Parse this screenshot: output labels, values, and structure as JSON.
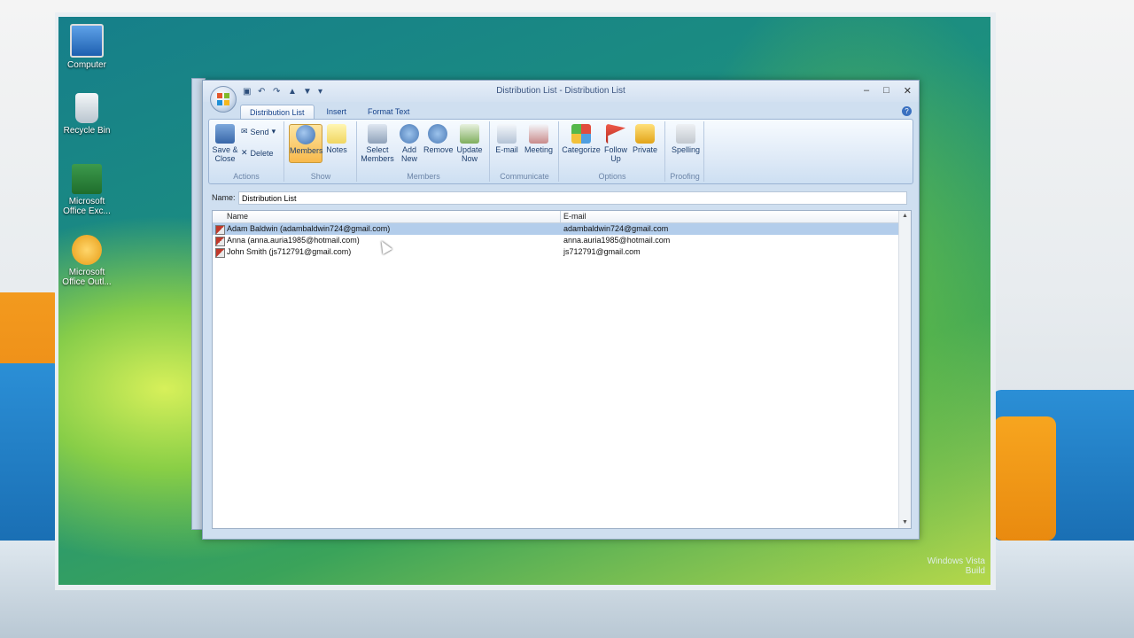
{
  "desktop": {
    "icons": [
      {
        "label": "Computer",
        "icon": "computer-icon"
      },
      {
        "label": "Recycle Bin",
        "icon": "recycle-bin-icon"
      },
      {
        "label": "Microsoft Office Exc...",
        "icon": "excel-icon"
      },
      {
        "label": "Microsoft Office Outl...",
        "icon": "outlook-icon"
      }
    ],
    "watermark": "Windows Vista\nBuild"
  },
  "window": {
    "title": "Distribution List - Distribution List",
    "tabs": [
      "Distribution List",
      "Insert",
      "Format Text"
    ],
    "active_tab": 0,
    "ribbon": {
      "groups": [
        {
          "label": "Actions",
          "buttons": [
            {
              "label": "Save & Close",
              "icon": "save-close-icon"
            },
            {
              "label": "Send",
              "icon": "send-icon"
            },
            {
              "label": "Delete",
              "icon": "delete-icon"
            }
          ]
        },
        {
          "label": "Show",
          "buttons": [
            {
              "label": "Members",
              "icon": "members-icon"
            },
            {
              "label": "Notes",
              "icon": "notes-icon"
            }
          ]
        },
        {
          "label": "Members",
          "buttons": [
            {
              "label": "Select Members",
              "icon": "select-members-icon"
            },
            {
              "label": "Add New",
              "icon": "add-new-icon"
            },
            {
              "label": "Remove",
              "icon": "remove-icon"
            },
            {
              "label": "Update Now",
              "icon": "update-now-icon"
            }
          ]
        },
        {
          "label": "Communicate",
          "buttons": [
            {
              "label": "E-mail",
              "icon": "email-icon"
            },
            {
              "label": "Meeting",
              "icon": "meeting-icon"
            }
          ]
        },
        {
          "label": "Options",
          "buttons": [
            {
              "label": "Categorize",
              "icon": "categorize-icon"
            },
            {
              "label": "Follow Up",
              "icon": "follow-up-icon"
            },
            {
              "label": "Private",
              "icon": "private-icon"
            }
          ]
        },
        {
          "label": "Proofing",
          "buttons": [
            {
              "label": "Spelling",
              "icon": "spelling-icon"
            }
          ]
        }
      ]
    },
    "name_label": "Name:",
    "name_value": "Distribution List",
    "list": {
      "columns": [
        "Name",
        "E-mail"
      ],
      "rows": [
        {
          "name": "Adam Baldwin (adambaldwin724@gmail.com)",
          "email": "adambaldwin724@gmail.com",
          "selected": true
        },
        {
          "name": "Anna (anna.auria1985@hotmail.com)",
          "email": "anna.auria1985@hotmail.com",
          "selected": false
        },
        {
          "name": "John Smith (js712791@gmail.com)",
          "email": "js712791@gmail.com",
          "selected": false
        }
      ]
    }
  }
}
